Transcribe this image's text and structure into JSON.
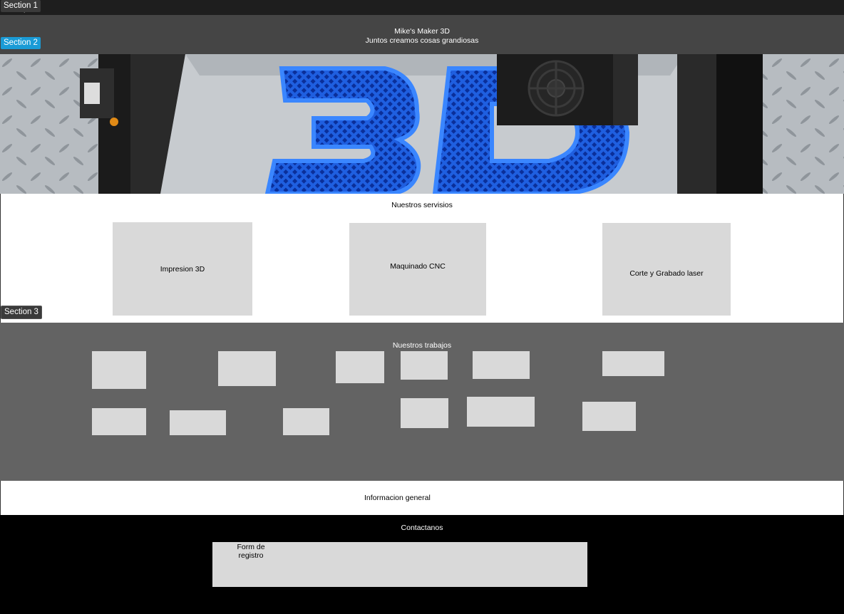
{
  "frame_labels": {
    "section1": "Section 1",
    "section2": "Section 2",
    "section3": "Section 3"
  },
  "header": {
    "site_title": "Mike's Maker 3D",
    "tagline": "Juntos creamos cosas grandiosas"
  },
  "services": {
    "heading": "Nuestros servisios",
    "items": [
      {
        "label": "Impresion 3D"
      },
      {
        "label": "Maquinado CNC"
      },
      {
        "label": "Corte y Grabado laser"
      }
    ]
  },
  "works": {
    "heading": "Nuestros trabajos",
    "item_count": 12
  },
  "info": {
    "heading": "Informacion general"
  },
  "contact": {
    "heading": "Contactanos",
    "form_label": "Form de registro"
  },
  "colors": {
    "header_bg": "#454545",
    "works_bg": "#636363",
    "placeholder_gray": "#d9d9d9",
    "contact_bg": "#000000",
    "accent_blue": "#1a9bd6"
  }
}
